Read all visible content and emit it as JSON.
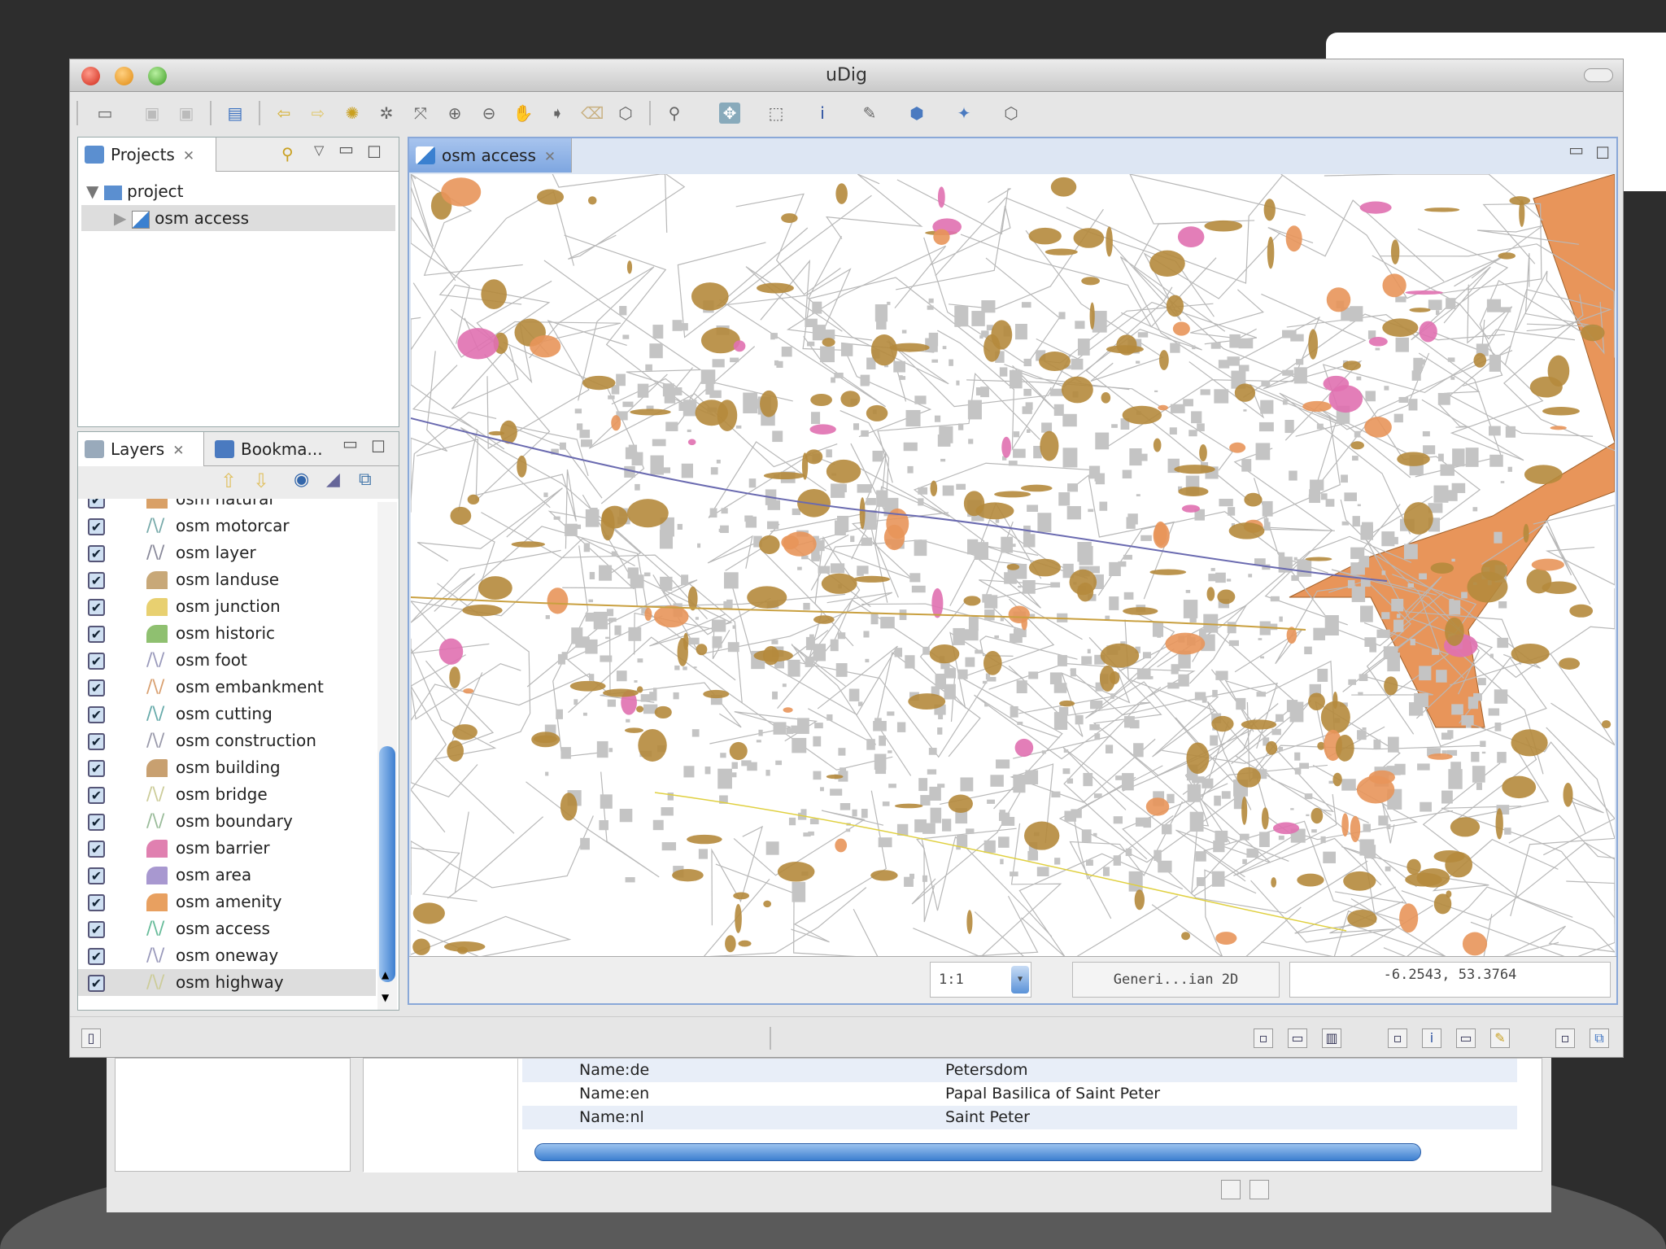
{
  "window": {
    "title": "uDig"
  },
  "projects": {
    "tab_label": "Projects",
    "root": "project",
    "child": "osm access"
  },
  "layers": {
    "tab_label": "Layers",
    "bookmarks_label": "Bookma...",
    "items": [
      {
        "name": "osm natural",
        "icon": "polygon",
        "color": "#d9a066"
      },
      {
        "name": "osm motorcar",
        "icon": "line",
        "color": "#7aa"
      },
      {
        "name": "osm layer",
        "icon": "line",
        "color": "#889"
      },
      {
        "name": "osm landuse",
        "icon": "polygon",
        "color": "#c8a878"
      },
      {
        "name": "osm junction",
        "icon": "polygon",
        "color": "#e8d070"
      },
      {
        "name": "osm historic",
        "icon": "polygon",
        "color": "#8fc070"
      },
      {
        "name": "osm foot",
        "icon": "line",
        "color": "#99b"
      },
      {
        "name": "osm embankment",
        "icon": "line",
        "color": "#d9a070"
      },
      {
        "name": "osm cutting",
        "icon": "line",
        "color": "#6aa"
      },
      {
        "name": "osm construction",
        "icon": "line",
        "color": "#99a"
      },
      {
        "name": "osm building",
        "icon": "polygon",
        "color": "#c8a070"
      },
      {
        "name": "osm bridge",
        "icon": "line",
        "color": "#cc9"
      },
      {
        "name": "osm boundary",
        "icon": "line",
        "color": "#9b9"
      },
      {
        "name": "osm barrier",
        "icon": "polygon",
        "color": "#e080b0"
      },
      {
        "name": "osm area",
        "icon": "polygon",
        "color": "#a898d0"
      },
      {
        "name": "osm amenity",
        "icon": "polygon",
        "color": "#e8a060"
      },
      {
        "name": "osm access",
        "icon": "line",
        "color": "#6b9"
      },
      {
        "name": "osm oneway",
        "icon": "line",
        "color": "#99b"
      },
      {
        "name": "osm highway",
        "icon": "line",
        "color": "#cc9"
      }
    ]
  },
  "editor": {
    "tab_label": "osm access",
    "scale": "1:1",
    "crs": "Generi...ian 2D",
    "coordinates": "-6.2543, 53.3764"
  },
  "properties": {
    "rows": [
      {
        "key": "Name:de",
        "value": "Petersdom"
      },
      {
        "key": "Name:en",
        "value": "Papal Basilica of Saint Peter"
      },
      {
        "key": "Name:nl",
        "value": "Saint Peter"
      }
    ]
  },
  "colors": {
    "road": "#b8b8b8",
    "building": "#b58a3c",
    "amenity": "#e8955a",
    "barrier": "#e070b0"
  }
}
